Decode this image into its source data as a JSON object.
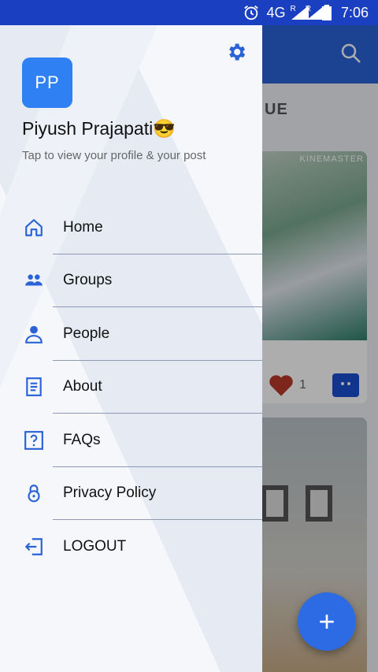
{
  "status_bar": {
    "network": "4G",
    "roaming_1": "R",
    "roaming_2": "R",
    "time": "7:06"
  },
  "background": {
    "section_title": "UE",
    "watermark": "KINEMASTER",
    "like_count": "1"
  },
  "drawer": {
    "avatar_initials": "PP",
    "user_name": "Piyush Prajapati😎",
    "profile_hint": "Tap to view your profile & your post",
    "menu": [
      {
        "label": "Home",
        "icon": "home-icon"
      },
      {
        "label": "Groups",
        "icon": "groups-icon"
      },
      {
        "label": "People",
        "icon": "person-icon"
      },
      {
        "label": "About",
        "icon": "document-icon"
      },
      {
        "label": "FAQs",
        "icon": "question-icon"
      },
      {
        "label": "Privacy Policy",
        "icon": "lock-icon"
      },
      {
        "label": "LOGOUT",
        "icon": "logout-icon"
      }
    ]
  },
  "fab": {
    "label": "+"
  },
  "colors": {
    "accent": "#2c6be3",
    "icon": "#2a62d8",
    "status_bar": "#1a3fc0",
    "like": "#b83a2a"
  }
}
